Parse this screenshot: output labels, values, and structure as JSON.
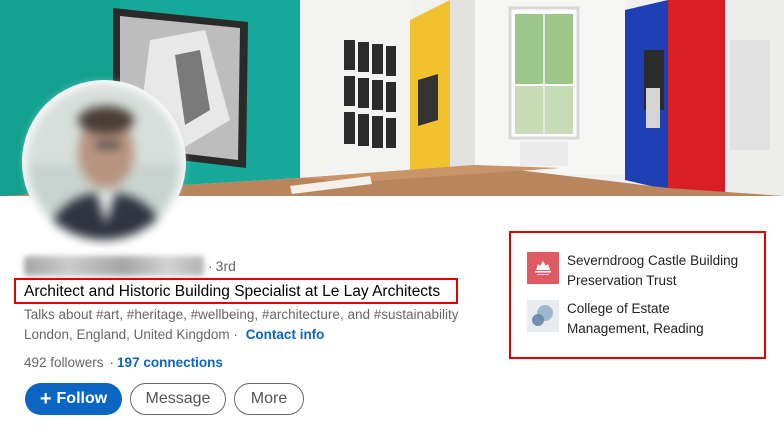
{
  "profile": {
    "degree": "3rd",
    "headline": "Architect and Historic Building Specialist at Le Lay Architects",
    "talks_about": "Talks about #art, #heritage, #wellbeing, #architecture, and #sustainability",
    "location": "London, England, United Kingdom",
    "contact_info": "Contact info",
    "followers": "492 followers",
    "connections": "197 connections"
  },
  "actions": {
    "follow": "Follow",
    "message": "Message",
    "more": "More"
  },
  "education": [
    {
      "name": "Severndroog Castle Building Preservation Trust",
      "logo": "severndroog-castle-logo"
    },
    {
      "name": "College of Estate Management, Reading",
      "logo": "college-of-estate-management-logo"
    }
  ],
  "colors": {
    "accent": "#0a66c2",
    "highlight_border": "#e30000",
    "banner_green": "#16a085",
    "banner_yellow": "#f2c12e",
    "banner_blue": "#1f3fb5",
    "banner_red": "#d91f26"
  }
}
